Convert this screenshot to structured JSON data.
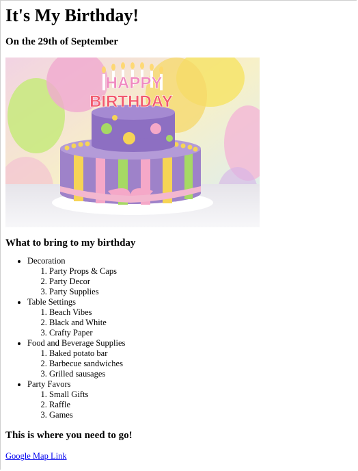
{
  "page": {
    "title": "It's My Birthday!",
    "date": "On the 29th of September"
  },
  "image": {
    "alt": "Happy Birthday cake",
    "candle_text": "HAPPY BIRTHDAY",
    "colors": {
      "cake_purple": "#8e6fc0",
      "pink": "#f5a8c8",
      "yellow": "#f6d455",
      "green": "#9ed65c"
    }
  },
  "bring": {
    "heading": "What to bring to my birthday",
    "categories": [
      {
        "label": "Decoration",
        "items": [
          "Party Props & Caps",
          "Party Decor",
          "Party Supplies"
        ]
      },
      {
        "label": "Table Settings",
        "items": [
          "Beach Vibes",
          "Black and White",
          "Crafty Paper"
        ]
      },
      {
        "label": "Food and Beverage Supplies",
        "items": [
          "Baked potato bar",
          "Barbecue sandwiches",
          "Grilled sausages"
        ]
      },
      {
        "label": "Party Favors",
        "items": [
          "Small Gifts",
          "Raffle",
          "Games"
        ]
      }
    ]
  },
  "location": {
    "heading": "This is where you need to go!",
    "link_label": "Google Map Link"
  }
}
